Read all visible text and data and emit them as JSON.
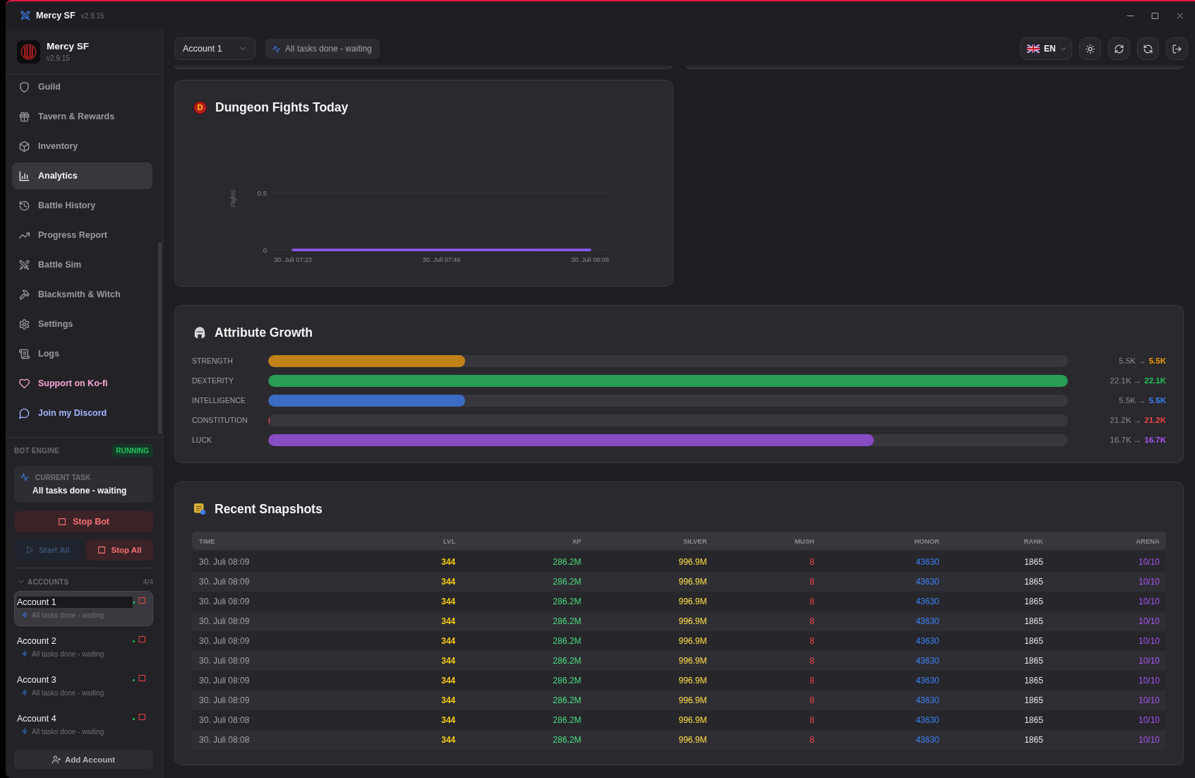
{
  "window": {
    "title": "Mercy SF",
    "version": "v2.9.15"
  },
  "sidebar": {
    "app_name": "Mercy SF",
    "app_version": "v2.9.15",
    "nav_items": [
      {
        "label": "Guild",
        "selected": false
      },
      {
        "label": "Tavern & Rewards",
        "selected": false
      },
      {
        "label": "Inventory",
        "selected": false
      },
      {
        "label": "Analytics",
        "selected": true
      },
      {
        "label": "Battle History",
        "selected": false
      },
      {
        "label": "Progress Report",
        "selected": false
      },
      {
        "label": "Battle Sim",
        "selected": false
      },
      {
        "label": "Blacksmith & Witch",
        "selected": false
      },
      {
        "label": "Settings",
        "selected": false
      },
      {
        "label": "Logs",
        "selected": false
      }
    ],
    "links": [
      {
        "label": "Support on Ko-fi",
        "color": "#f9a8d4"
      },
      {
        "label": "Join my Discord",
        "color": "#a5b4fc"
      }
    ],
    "bot_engine": {
      "label": "BOT ENGINE",
      "status": "RUNNING",
      "current_task_label": "CURRENT TASK",
      "current_task": "All tasks done - waiting",
      "stop_button": "Stop Bot",
      "bulk_buttons": [
        {
          "label": "Start All",
          "kind": "start",
          "disabled": true
        },
        {
          "label": "Stop All",
          "kind": "stop",
          "disabled": false
        }
      ]
    },
    "accounts": {
      "title": "ACCOUNTS",
      "count": "4/4",
      "expanded": true,
      "items": [
        {
          "name": "Account 1",
          "status": "All tasks done - waiting",
          "selected": true,
          "online": true
        },
        {
          "name": "Account 2",
          "status": "All tasks done - waiting",
          "selected": false,
          "online": true
        },
        {
          "name": "Account 3",
          "status": "All tasks done - waiting",
          "selected": false,
          "online": true
        },
        {
          "name": "Account 4",
          "status": "All tasks done - waiting",
          "selected": false,
          "online": true
        }
      ]
    },
    "add_account_button": "Add Account"
  },
  "topbar": {
    "account_select": "Account 1",
    "status": "All tasks done - waiting",
    "language": "EN"
  },
  "dungeon_fights": {
    "title": "Dungeon Fights Today",
    "badge": "D",
    "chart_data": {
      "type": "line",
      "ylabel": "Fights",
      "categories": [
        "30. Juli 07:23",
        "30. Juli 07:46",
        "30. Juli 08:09"
      ],
      "series": [
        {
          "color": "#8b5cf6",
          "values": [
            0,
            0,
            0
          ]
        }
      ],
      "ylim": [
        0,
        0.5
      ],
      "yticks": [
        0,
        0.5
      ]
    }
  },
  "attribute_growth": {
    "title": "Attribute Growth",
    "attributes": [
      {
        "name": "STRENGTH",
        "level": 0.246,
        "from": "5.5K",
        "arrow": "→",
        "to": "5.5K",
        "color": "#f59e0b"
      },
      {
        "name": "DEXTERITY",
        "level": 1,
        "from": "22.1K",
        "arrow": "→",
        "to": "22.1K",
        "color": "#22c55e"
      },
      {
        "name": "INTELLIGENCE",
        "level": 0.246,
        "from": "5.5K",
        "arrow": "→",
        "to": "5.5K",
        "color": "#3b82f6"
      },
      {
        "name": "CONSTITUTION",
        "level": 0,
        "from": "21.2K",
        "arrow": "→",
        "to": "21.2K",
        "color": "#ef4444"
      },
      {
        "name": "LUCK",
        "level": 0.757,
        "from": "16.7K",
        "arrow": "→",
        "to": "16.7K",
        "color": "#a855f7"
      }
    ]
  },
  "recent_snapshots": {
    "title": "Recent Snapshots",
    "columns": [
      {
        "label": "TIME",
        "color": "#a1a1aa",
        "bold": false
      },
      {
        "label": "LVL",
        "color": "#facc15",
        "bold": true
      },
      {
        "label": "XP",
        "color": "#4ade80",
        "bold": false
      },
      {
        "label": "SILVER",
        "color": "#fde047",
        "bold": false
      },
      {
        "label": "MUSH",
        "color": "#ef4444",
        "bold": false
      },
      {
        "label": "HONOR",
        "color": "#3b82f6",
        "bold": false
      },
      {
        "label": "RANK",
        "color": "#e4e4e7",
        "bold": false
      },
      {
        "label": "ARENA",
        "color": "#a855f7",
        "bold": false
      }
    ],
    "rows": [
      [
        "30. Juli 08:09",
        "344",
        "286.2M",
        "996.9M",
        "8",
        "43630",
        "1865",
        "10/10"
      ],
      [
        "30. Juli 08:09",
        "344",
        "286.2M",
        "996.9M",
        "8",
        "43630",
        "1865",
        "10/10"
      ],
      [
        "30. Juli 08:09",
        "344",
        "286.2M",
        "996.9M",
        "8",
        "43630",
        "1865",
        "10/10"
      ],
      [
        "30. Juli 08:09",
        "344",
        "286.2M",
        "996.9M",
        "8",
        "43630",
        "1865",
        "10/10"
      ],
      [
        "30. Juli 08:09",
        "344",
        "286.2M",
        "996.9M",
        "8",
        "43630",
        "1865",
        "10/10"
      ],
      [
        "30. Juli 08:09",
        "344",
        "286.2M",
        "996.9M",
        "8",
        "43630",
        "1865",
        "10/10"
      ],
      [
        "30. Juli 08:09",
        "344",
        "286.2M",
        "996.9M",
        "8",
        "43630",
        "1865",
        "10/10"
      ],
      [
        "30. Juli 08:09",
        "344",
        "286.2M",
        "996.9M",
        "8",
        "43630",
        "1865",
        "10/10"
      ],
      [
        "30. Juli 08:08",
        "344",
        "286.2M",
        "996.9M",
        "8",
        "43630",
        "1865",
        "10/10"
      ],
      [
        "30. Juli 08:08",
        "344",
        "286.2M",
        "996.9M",
        "8",
        "43630",
        "1865",
        "10/10"
      ]
    ]
  }
}
